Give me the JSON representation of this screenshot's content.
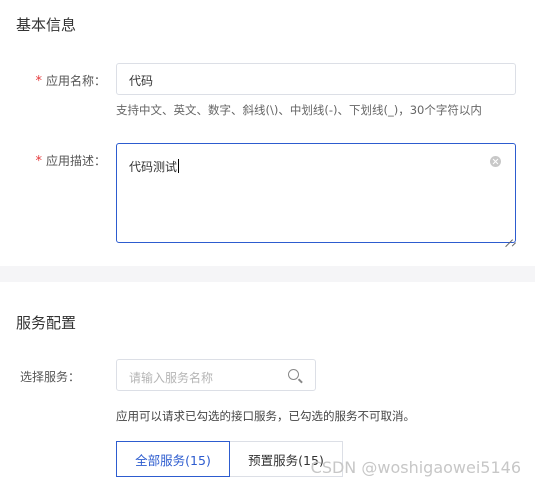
{
  "basic_info": {
    "title": "基本信息",
    "app_name": {
      "required_mark": "*",
      "label": "应用名称：",
      "value": "代码",
      "hint": "支持中文、英文、数字、斜线(\\)、中划线(-)、下划线(_)，30个字符以内"
    },
    "app_desc": {
      "required_mark": "*",
      "label": "应用描述：",
      "value": "代码测试"
    }
  },
  "service_config": {
    "title": "服务配置",
    "select_label": "选择服务：",
    "search_placeholder": "请输入服务名称",
    "note": "应用可以请求已勾选的接口服务，已勾选的服务不可取消。",
    "tabs": [
      {
        "label": "全部服务(15)",
        "active": true
      },
      {
        "label": "预置服务(15)",
        "active": false
      }
    ]
  },
  "watermark": "CSDN @woshigaowei5146",
  "colors": {
    "accent": "#2d5ccf",
    "required": "#e4393c"
  },
  "icons": [
    "clear-icon",
    "search-icon",
    "resize-handle-icon"
  ]
}
